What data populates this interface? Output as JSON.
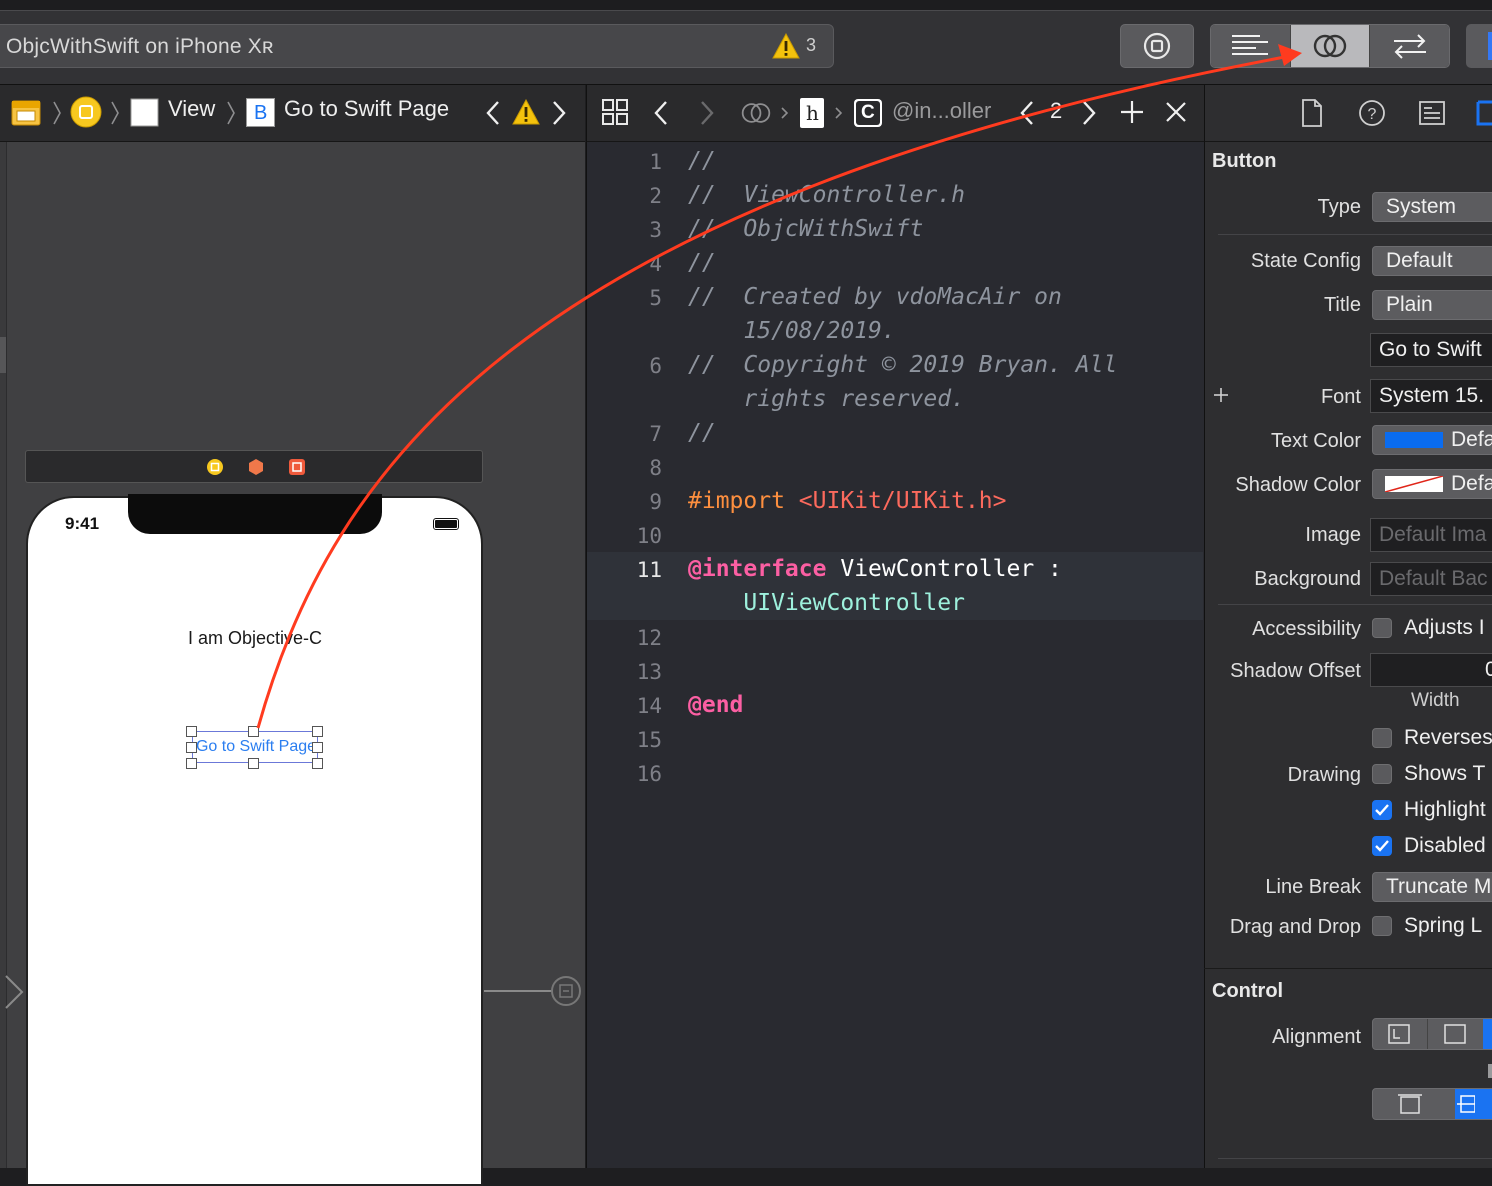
{
  "toolbar": {
    "scheme_title": "ObjcWithSwift on iPhone Xʀ",
    "warning_count": "3"
  },
  "left_jumpbar": {
    "items": [
      "View",
      "Go to Swift Page"
    ],
    "button_badge": "B"
  },
  "canvas": {
    "status_time": "9:41",
    "label_text": "I am Objective-C",
    "button_text": "Go to Swift Page"
  },
  "code_jumpbar": {
    "class_badge": "C",
    "header_badge": "h",
    "path_text": "@in...oller",
    "counterpart_count": "2"
  },
  "code": {
    "lines": [
      {
        "n": "1",
        "text": "//"
      },
      {
        "n": "2",
        "text": "//  ViewController.h"
      },
      {
        "n": "3",
        "text": "//  ObjcWithSwift"
      },
      {
        "n": "4",
        "text": "//"
      },
      {
        "n": "5",
        "text": "//  Created by vdoMacAir on",
        "cont": "    15/08/2019."
      },
      {
        "n": "6",
        "text": "//  Copyright © 2019 Bryan. All",
        "cont": "    rights reserved."
      },
      {
        "n": "7",
        "text": "//"
      },
      {
        "n": "8",
        "text": ""
      },
      {
        "n": "9",
        "directive": "#import",
        "path": "<UIKit/UIKit.h>"
      },
      {
        "n": "10",
        "text": ""
      },
      {
        "n": "11",
        "keyword": "@interface",
        "name": "ViewController :",
        "super": "UIViewController"
      },
      {
        "n": "12",
        "text": ""
      },
      {
        "n": "13",
        "text": ""
      },
      {
        "n": "14",
        "keyword": "@end"
      },
      {
        "n": "15",
        "text": ""
      },
      {
        "n": "16",
        "text": ""
      }
    ]
  },
  "inspector": {
    "section_button": "Button",
    "section_control": "Control",
    "type": {
      "label": "Type",
      "value": "System"
    },
    "state_config": {
      "label": "State Config",
      "value": "Default"
    },
    "title": {
      "label": "Title",
      "value": "Plain",
      "text_value": "Go to Swift"
    },
    "font": {
      "label": "Font",
      "value": "System 15."
    },
    "text_color": {
      "label": "Text Color",
      "value": "Defa",
      "swatch": "#0a6cf0"
    },
    "shadow_color": {
      "label": "Shadow Color",
      "value": "Defa"
    },
    "image": {
      "label": "Image",
      "placeholder": "Default Ima"
    },
    "background": {
      "label": "Background",
      "placeholder": "Default Bac"
    },
    "accessibility": {
      "label": "Accessibility",
      "check": "Adjusts I",
      "checked": false
    },
    "shadow_offset": {
      "label": "Shadow Offset",
      "value": "0",
      "sub": "Width"
    },
    "reverses": {
      "check": "Reverses",
      "checked": false
    },
    "drawing": {
      "label": "Drawing",
      "check": "Shows T",
      "checked": false
    },
    "highlight": {
      "check": "Highlight",
      "checked": true
    },
    "disabled": {
      "check": "Disabled",
      "checked": true
    },
    "line_break": {
      "label": "Line Break",
      "value": "Truncate M"
    },
    "drag_drop": {
      "label": "Drag and Drop",
      "check": "Spring L",
      "checked": false
    },
    "alignment": {
      "label": "Alignment"
    }
  },
  "colors": {
    "accent": "#1a73f2",
    "annotation_arrow": "#ff3b1f",
    "warning": "#f4c20d"
  }
}
